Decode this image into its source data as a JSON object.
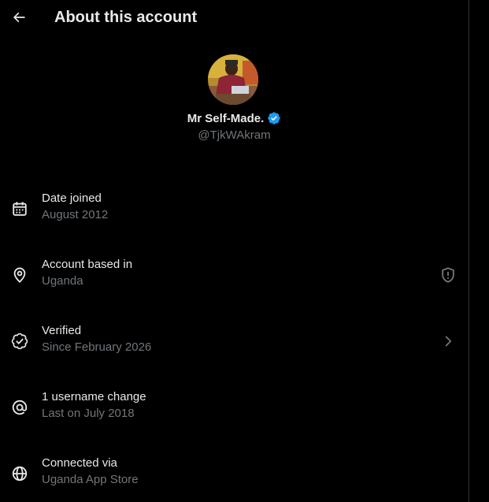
{
  "header": {
    "title": "About this account",
    "back_icon": "arrow-left-icon"
  },
  "profile": {
    "display_name": "Mr Self-Made.",
    "handle": "@TjkWAkram",
    "verified_badge_color": "#1d9bf0"
  },
  "rows": [
    {
      "title": "Date joined",
      "subtitle": "August 2012",
      "icon": "calendar-icon"
    },
    {
      "title": "Account based in",
      "subtitle": "Uganda",
      "icon": "location-pin-icon",
      "trailing_icon": "shield-alert-icon"
    },
    {
      "title": "Verified",
      "subtitle": "Since February 2026",
      "icon": "verified-check-icon",
      "trailing_icon": "chevron-right-icon"
    },
    {
      "title": "1 username change",
      "subtitle": "Last on July 2018",
      "icon": "at-sign-icon"
    },
    {
      "title": "Connected via",
      "subtitle": "Uganda App Store",
      "icon": "globe-icon"
    }
  ],
  "colors": {
    "background": "#000000",
    "primary_text": "#e7e9ea",
    "secondary_text": "#71767b",
    "divider": "#2f3336",
    "accent": "#1d9bf0"
  }
}
